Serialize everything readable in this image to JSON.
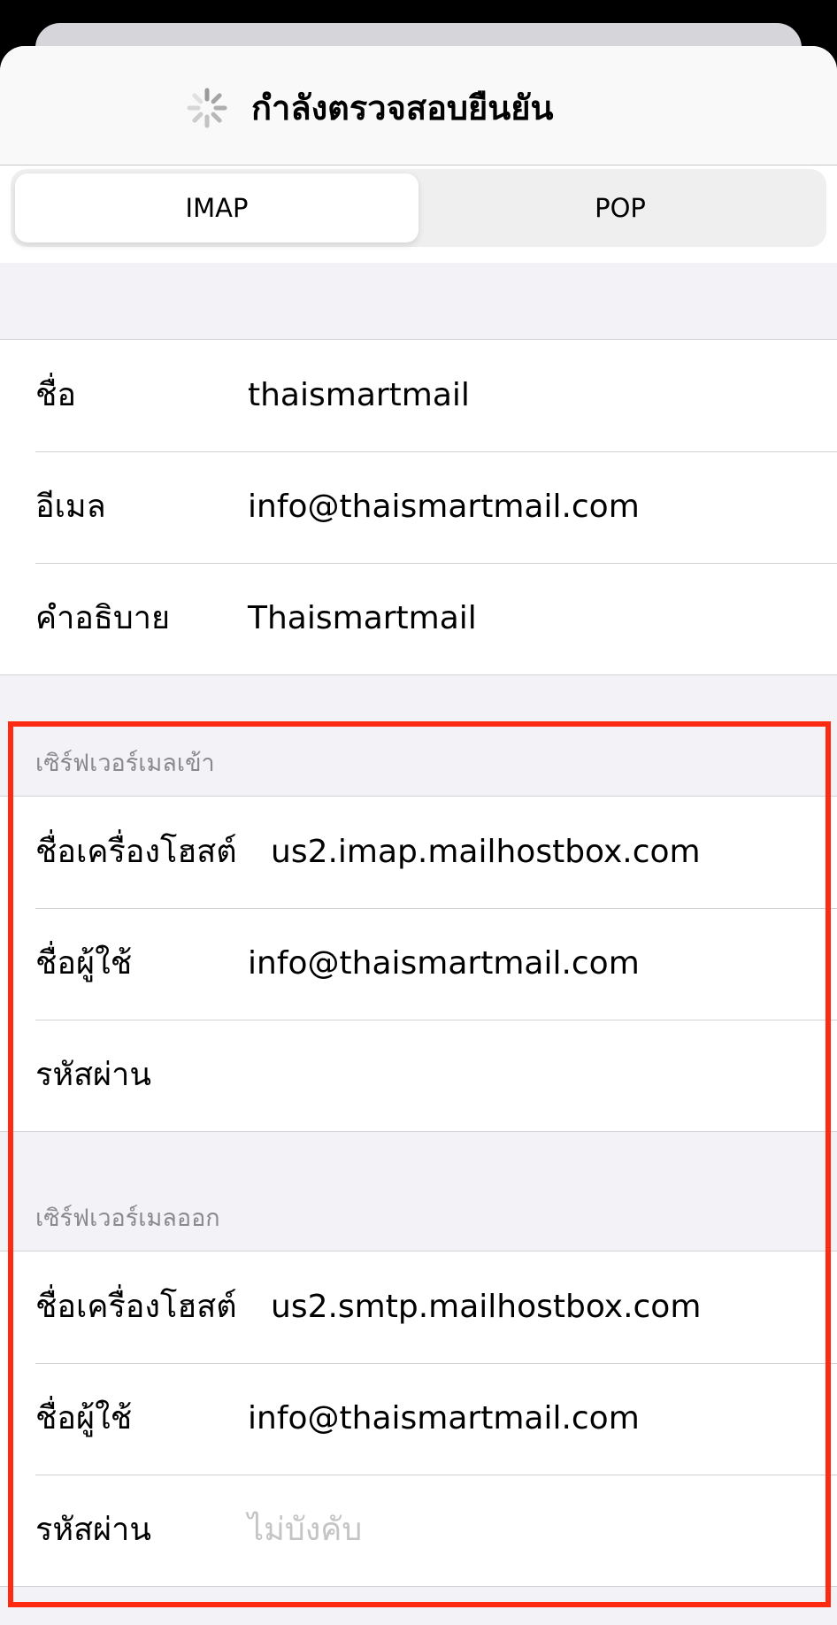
{
  "nav": {
    "title": "กำลังตรวจสอบยืนยัน",
    "spinner_icon": "activity-spinner-icon"
  },
  "segments": [
    {
      "label": "IMAP",
      "selected": true
    },
    {
      "label": "POP",
      "selected": false
    }
  ],
  "account": [
    {
      "label": "ชื่อ",
      "value": "thaismartmail"
    },
    {
      "label": "อีเมล",
      "value": "info@thaismartmail.com"
    },
    {
      "label": "คำอธิบาย",
      "value": "Thaismartmail"
    }
  ],
  "incoming": {
    "header": "เซิร์ฟเวอร์เมลเข้า",
    "host_label": "ชื่อเครื่องโฮสต์",
    "host_value": "us2.imap.mailhostbox.com",
    "user_label": "ชื่อผู้ใช้",
    "user_value": "info@thaismartmail.com",
    "password_label": "รหัสผ่าน",
    "password_value": ""
  },
  "outgoing": {
    "header": "เซิร์ฟเวอร์เมลออก",
    "host_label": "ชื่อเครื่องโฮสต์",
    "host_value": "us2.smtp.mailhostbox.com",
    "user_label": "ชื่อผู้ใช้",
    "user_value": "info@thaismartmail.com",
    "password_label": "รหัสผ่าน",
    "password_placeholder": "ไม่บังคับ"
  },
  "colors": {
    "highlight": "#ff2a12",
    "placeholder": "#c4c4c6",
    "section_header": "#8a8a8e"
  }
}
